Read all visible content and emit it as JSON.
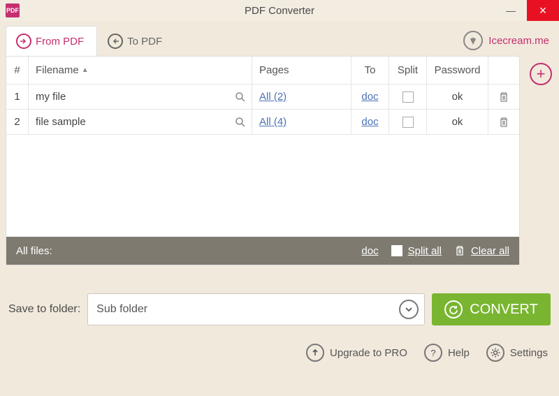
{
  "window": {
    "title": "PDF Converter"
  },
  "tabs": {
    "from": "From PDF",
    "to": "To PDF"
  },
  "brand": "Icecream.me",
  "headers": {
    "num": "#",
    "filename": "Filename",
    "pages": "Pages",
    "to": "To",
    "split": "Split",
    "password": "Password"
  },
  "rows": [
    {
      "num": "1",
      "filename": "my file",
      "pages": "All (2)",
      "to": "doc",
      "password": "ok"
    },
    {
      "num": "2",
      "filename": "file sample",
      "pages": "All (4)",
      "to": "doc",
      "password": "ok"
    }
  ],
  "footer": {
    "all_files": "All files:",
    "to": "doc",
    "split_all": "Split all",
    "clear_all": "Clear all"
  },
  "save": {
    "label": "Save to folder:",
    "value": "Sub folder",
    "convert": "CONVERT"
  },
  "bottom": {
    "upgrade": "Upgrade to PRO",
    "help": "Help",
    "settings": "Settings"
  }
}
